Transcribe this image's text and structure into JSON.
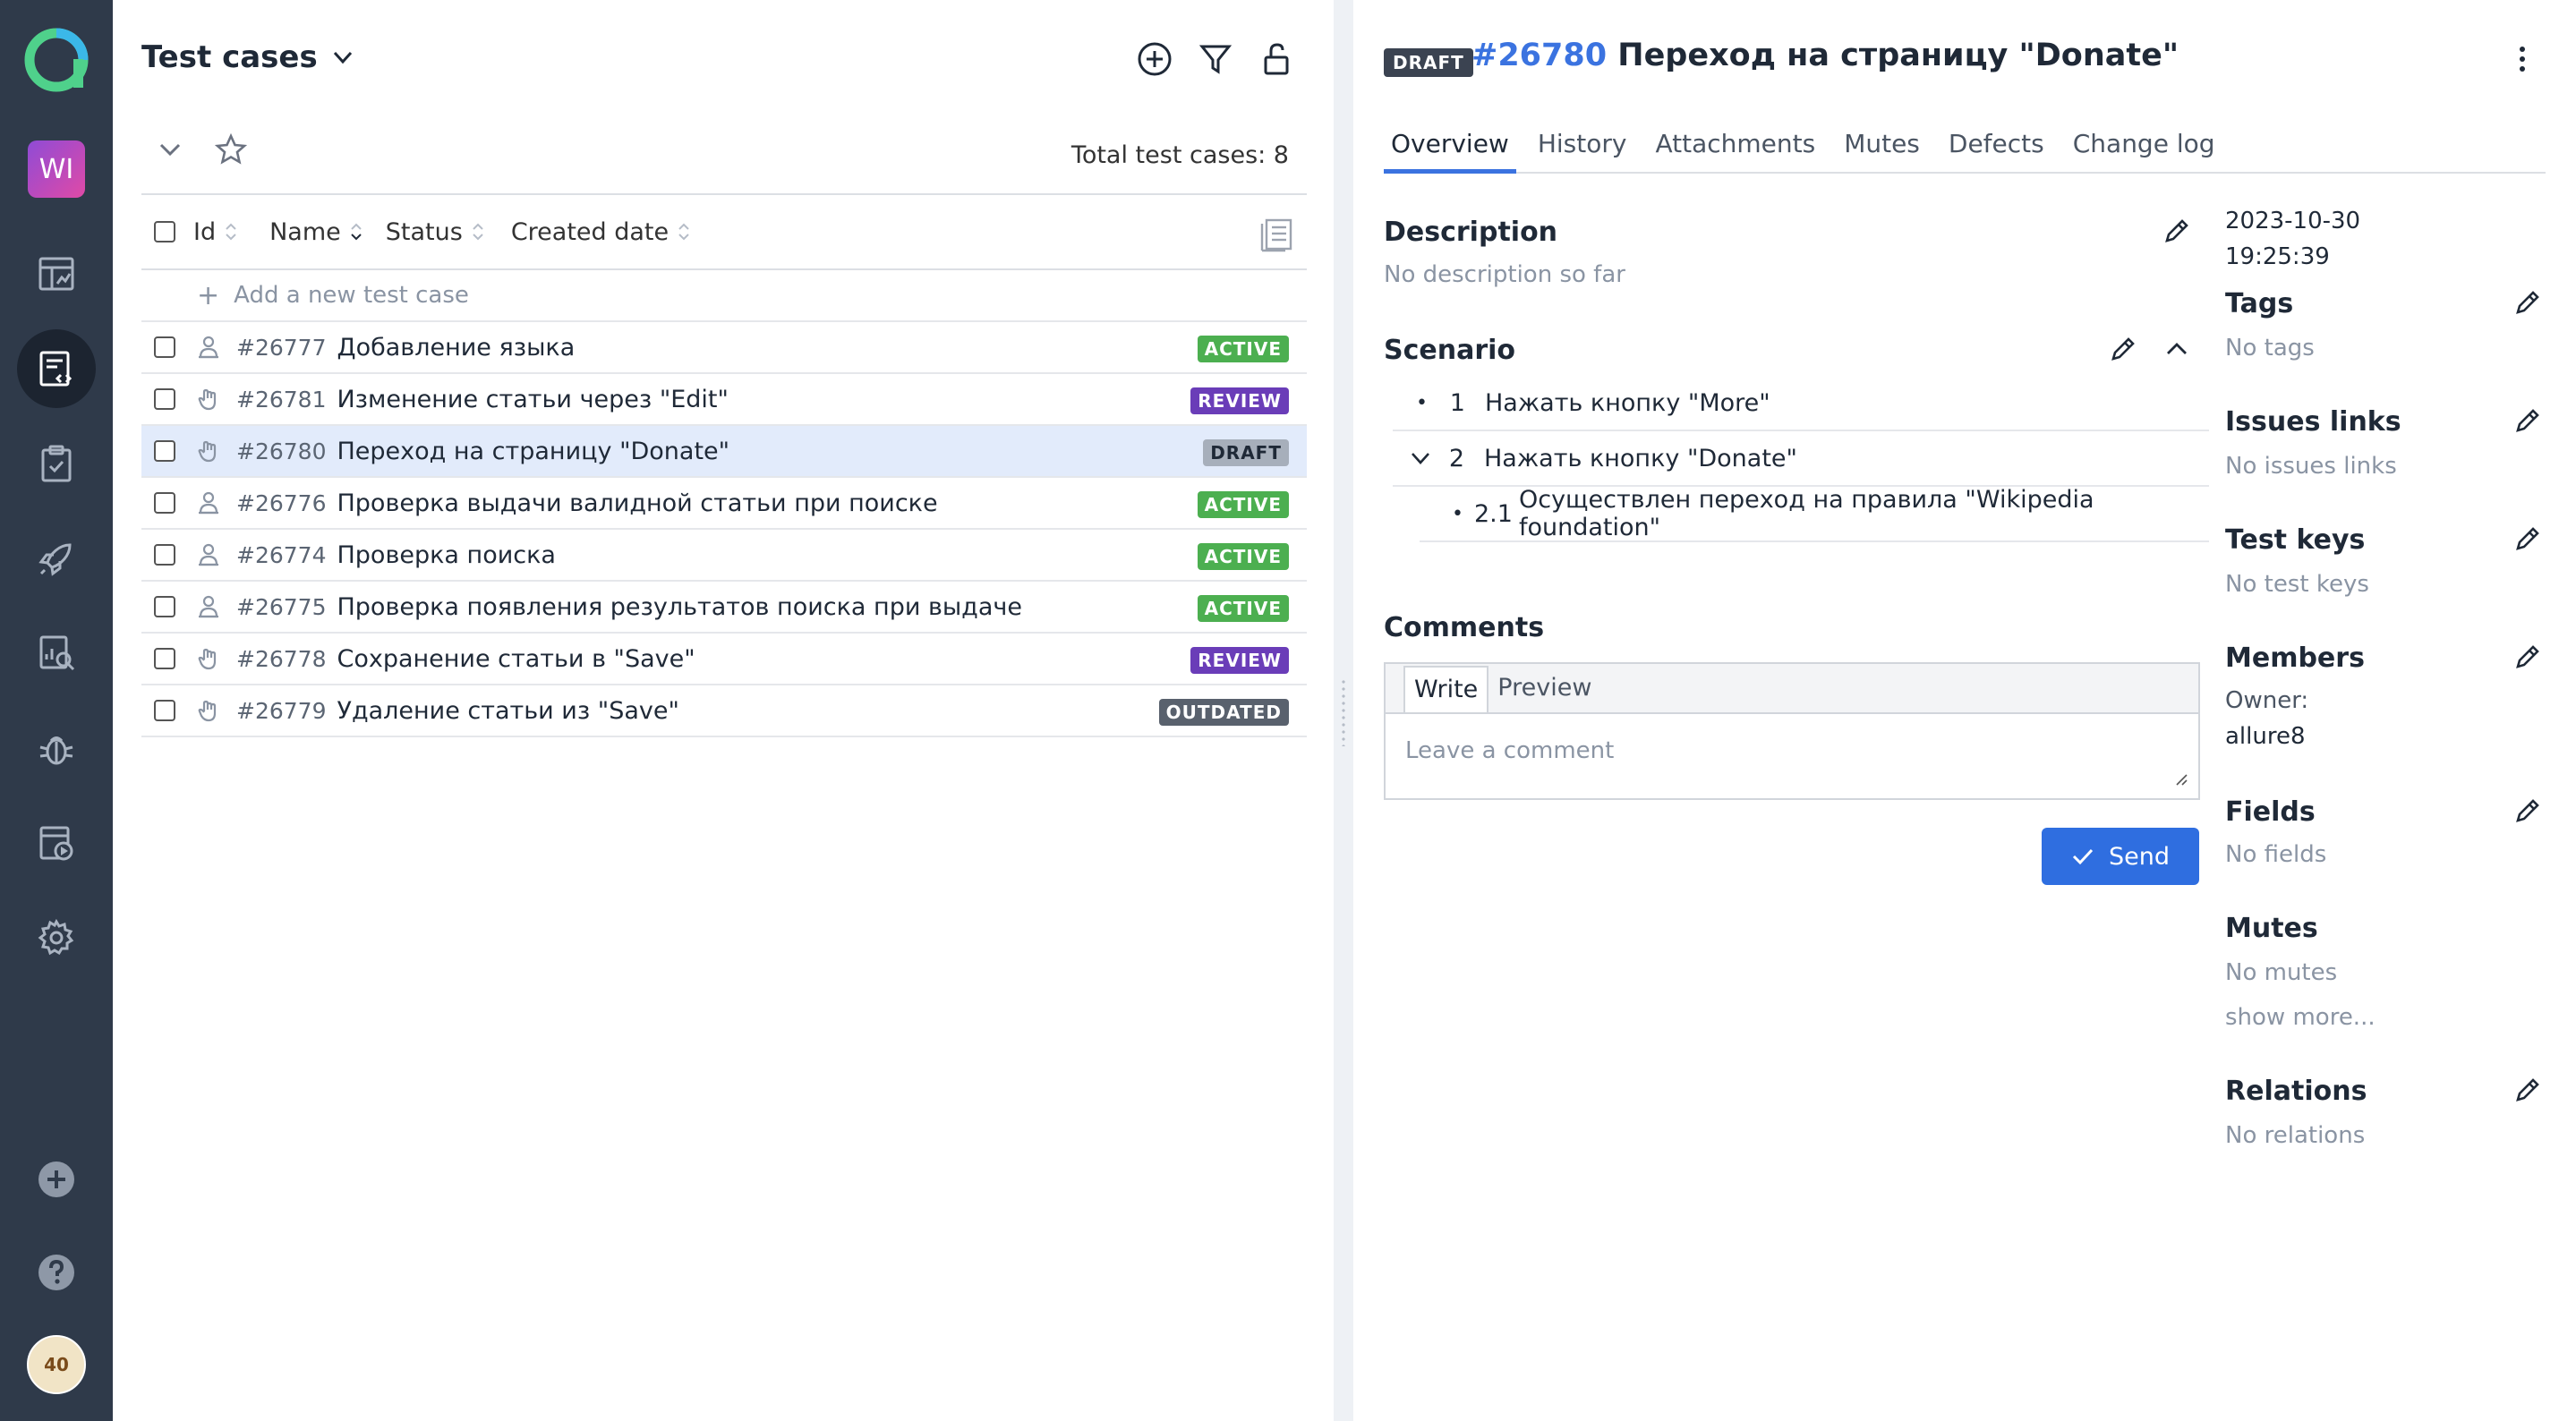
{
  "sidebar": {
    "workspace_badge": "WI",
    "avatar_text": "40"
  },
  "list": {
    "title": "Test cases",
    "total_label": "Total test cases: 8",
    "columns": {
      "id": "Id",
      "name": "Name",
      "status": "Status",
      "created": "Created date"
    },
    "add_new": "Add a new test case",
    "rows": [
      {
        "id": "#26777",
        "name": "Добавление языка",
        "status": "ACTIVE"
      },
      {
        "id": "#26781",
        "name": "Изменение статьи через \"Edit\"",
        "status": "REVIEW"
      },
      {
        "id": "#26780",
        "name": "Переход на страницу \"Donate\"",
        "status": "DRAFT"
      },
      {
        "id": "#26776",
        "name": "Проверка выдачи валидной статьи при поиске",
        "status": "ACTIVE"
      },
      {
        "id": "#26774",
        "name": "Проверка поиска",
        "status": "ACTIVE"
      },
      {
        "id": "#26775",
        "name": "Проверка появления результатов поиска при выдаче",
        "status": "ACTIVE"
      },
      {
        "id": "#26778",
        "name": "Сохранение статьи в \"Save\"",
        "status": "REVIEW"
      },
      {
        "id": "#26779",
        "name": "Удаление статьи из \"Save\"",
        "status": "OUTDATED"
      }
    ]
  },
  "colors": {
    "active": "#4caf50",
    "review": "#6a3db8",
    "draft": "#a7afbb",
    "outdated": "#59616d",
    "accent": "#3b73e0",
    "sidebar": "#2f3a4a"
  },
  "detail": {
    "status_tag": "DRAFT",
    "case_number": "#26780",
    "case_title": "Переход на страницу \"Donate\"",
    "tabs": [
      "Overview",
      "History",
      "Attachments",
      "Mutes",
      "Defects",
      "Change log"
    ],
    "description": {
      "title": "Description",
      "empty": "No description so far"
    },
    "scenario": {
      "title": "Scenario",
      "steps": [
        {
          "num": "1",
          "text": "Нажать кнопку \"More\""
        },
        {
          "num": "2",
          "text": "Нажать кнопку \"Donate\""
        },
        {
          "num": "2.1",
          "text": "Осуществлен переход на правила \"Wikipedia foundation\""
        }
      ]
    },
    "comments": {
      "title": "Comments",
      "tab_write": "Write",
      "tab_preview": "Preview",
      "placeholder": "Leave a comment",
      "send": "Send"
    },
    "side": {
      "created_date": "2023-10-30",
      "created_time": "19:25:39",
      "tags": {
        "title": "Tags",
        "value": "No tags"
      },
      "issues": {
        "title": "Issues links",
        "value": "No issues links"
      },
      "test_keys": {
        "title": "Test keys",
        "value": "No test keys"
      },
      "members": {
        "title": "Members",
        "owner_label": "Owner:",
        "owner": "allure8"
      },
      "fields": {
        "title": "Fields",
        "value": "No fields"
      },
      "mutes": {
        "title": "Mutes",
        "value": "No mutes",
        "more": "show more..."
      },
      "relations": {
        "title": "Relations",
        "value": "No relations"
      }
    }
  }
}
